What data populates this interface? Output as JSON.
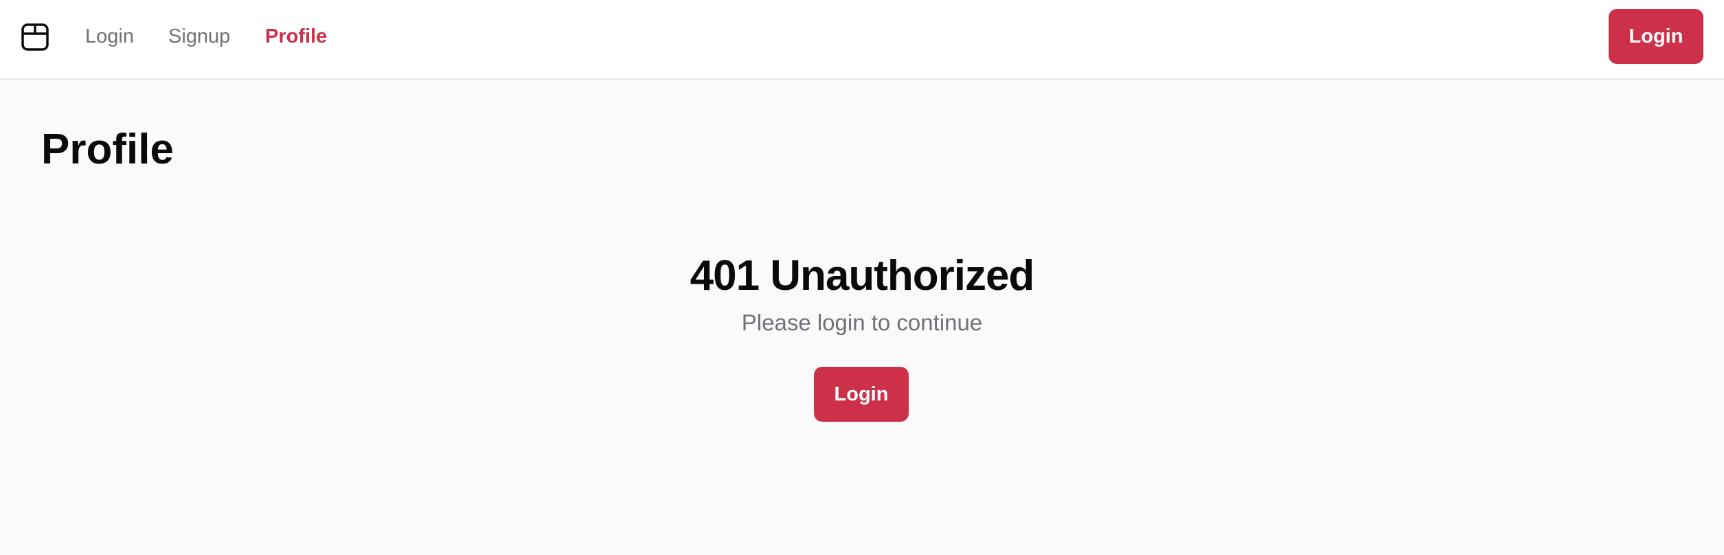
{
  "navbar": {
    "logo_icon": "package-box-icon",
    "links": [
      {
        "label": "Login",
        "active": false
      },
      {
        "label": "Signup",
        "active": false
      },
      {
        "label": "Profile",
        "active": true
      }
    ],
    "login_button_label": "Login"
  },
  "page": {
    "title": "Profile"
  },
  "error": {
    "heading": "401 Unauthorized",
    "message": "Please login to continue",
    "button_label": "Login"
  },
  "colors": {
    "accent": "#cc3149",
    "background": "#fafafa",
    "navbar_background": "#ffffff",
    "muted_text": "#71717a",
    "primary_text": "#0a0a0a"
  }
}
